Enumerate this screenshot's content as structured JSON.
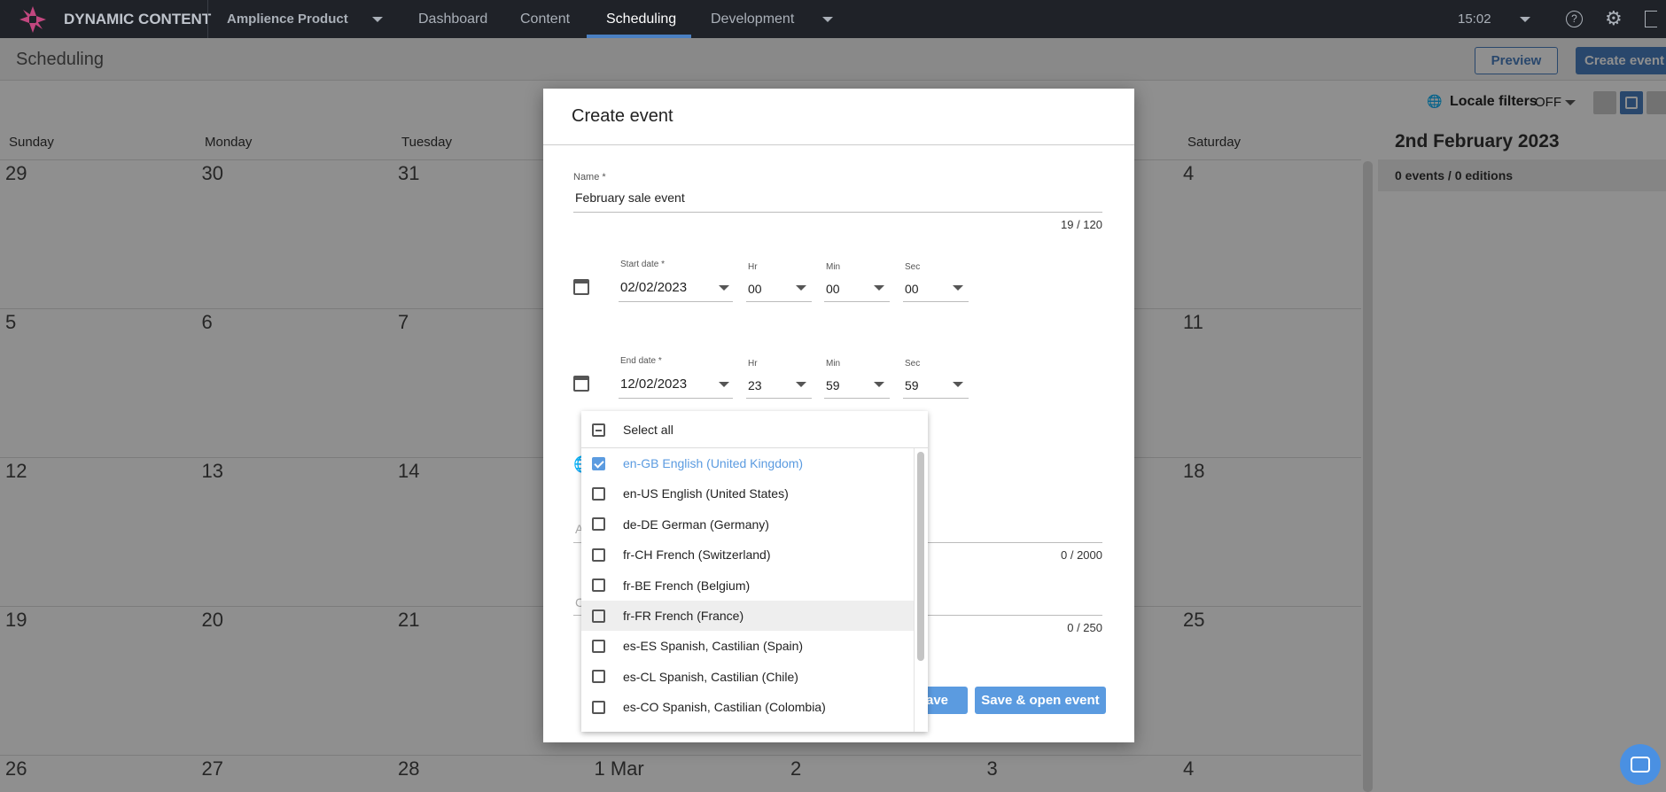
{
  "topbar": {
    "brand": "DYNAMIC CONTENT",
    "hub": "Amplience Product",
    "nav": [
      "Dashboard",
      "Content",
      "Scheduling",
      "Development"
    ],
    "active": "Scheduling",
    "time": "15:02"
  },
  "subheader": {
    "title": "Scheduling",
    "preview": "Preview",
    "create": "Create event"
  },
  "toolbar": {
    "locale_label": "Locale filters",
    "locale_value": "OFF"
  },
  "calendar": {
    "days": [
      "Sunday",
      "Monday",
      "Tuesday",
      "Saturday"
    ],
    "weeks": [
      [
        "29",
        "30",
        "31",
        "",
        "",
        "",
        "4"
      ],
      [
        "5",
        "6",
        "7",
        "",
        "",
        "",
        "11"
      ],
      [
        "12",
        "13",
        "14",
        "",
        "",
        "",
        "18"
      ],
      [
        "19",
        "20",
        "21",
        "",
        "",
        "",
        "25"
      ],
      [
        "26",
        "27",
        "28",
        "1 Mar",
        "2",
        "3",
        "4"
      ]
    ]
  },
  "panel": {
    "date": "2nd February 2023",
    "summary": "0 events / 0 editions"
  },
  "modal": {
    "title": "Create event",
    "name_label": "Name *",
    "name_value": "February sale event",
    "name_count": "19 / 120",
    "start": {
      "label": "Start date *",
      "date": "02/02/2023",
      "hr": "00",
      "min": "00",
      "sec": "00"
    },
    "end": {
      "label": "End date *",
      "date": "12/02/2023",
      "hr": "23",
      "min": "59",
      "sec": "59"
    },
    "hr_label": "Hr",
    "min_label": "Min",
    "sec_label": "Sec",
    "field_a_placeholder": "A",
    "field_a_count": "0 / 2000",
    "field_c_placeholder": "C",
    "field_c_count": "0 / 250",
    "save": "Save",
    "save_open": "Save & open event"
  },
  "locales": {
    "select_all": "Select all",
    "hovered": "fr-FR French (France)",
    "accent": "#5b9be0",
    "items": [
      {
        "label": "en-GB English (United Kingdom)",
        "checked": true
      },
      {
        "label": "en-US English (United States)",
        "checked": false
      },
      {
        "label": "de-DE German (Germany)",
        "checked": false
      },
      {
        "label": "fr-CH French (Switzerland)",
        "checked": false
      },
      {
        "label": "fr-BE French (Belgium)",
        "checked": false
      },
      {
        "label": "fr-FR French (France)",
        "checked": false
      },
      {
        "label": "es-ES Spanish, Castilian (Spain)",
        "checked": false
      },
      {
        "label": "es-CL Spanish, Castilian (Chile)",
        "checked": false
      },
      {
        "label": "es-CO Spanish, Castilian (Colombia)",
        "checked": false
      }
    ]
  }
}
